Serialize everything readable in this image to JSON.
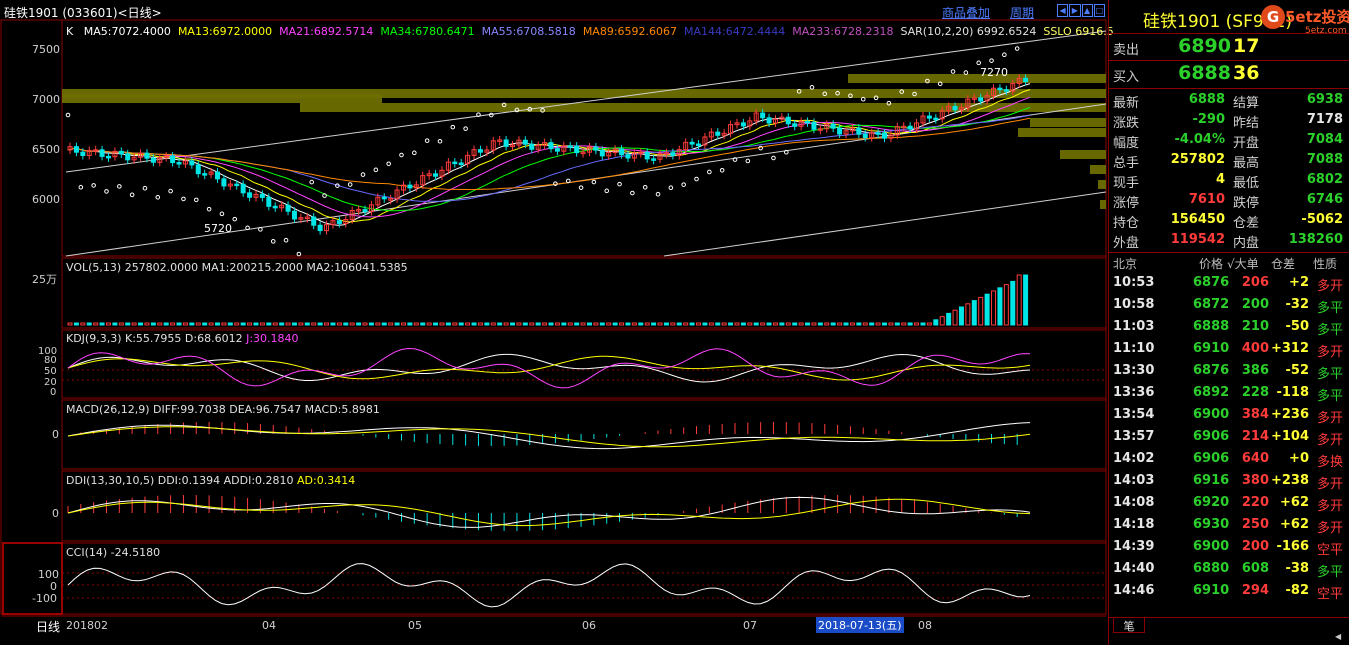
{
  "header": {
    "title": "硅铁1901 (033601)<日线>",
    "overlay_link": "商品叠加",
    "period_link": "周期",
    "btn_icons": [
      "left-arrow-icon",
      "right-arrow-icon",
      "up-arrow-icon",
      "down-arrow-icon",
      "maximize-icon",
      "close-icon"
    ]
  },
  "ma_legend": {
    "k": "K",
    "ma5": "MA5:7072.4000",
    "ma13": "MA13:6972.0000",
    "ma21": "MA21:6892.5714",
    "ma34": "MA34:6780.6471",
    "ma55": "MA55:6708.5818",
    "ma89": "MA89:6592.6067",
    "ma144": "MA144:6472.4444",
    "ma233": "MA233:6728.2318",
    "sar": "SAR(10,2,20) 6992.6524",
    "sslo": "SSLO 6916.5"
  },
  "price_axis": [
    "7500",
    "7000",
    "6500",
    "6000"
  ],
  "price_markers": {
    "high": "7270",
    "low": "5720"
  },
  "vol": {
    "label": "VOL(5,13) 257802.0000 MA1:200215.2000 MA2:106041.5385",
    "axis": "25万"
  },
  "kdj": {
    "label_main": "KDJ(9,3,3) K:55.7955 D:68.6012",
    "label_j": "J:30.1840",
    "axis": [
      "100",
      "80",
      "50",
      "20",
      "0"
    ]
  },
  "macd": {
    "label": "MACD(26,12,9) DIFF:99.7038 DEA:96.7547 MACD:5.8981",
    "axis": "0"
  },
  "ddi": {
    "label": "DDI(13,30,10,5) DDI:0.1394 ADDI:0.2810",
    "label_ad": "AD:0.3414",
    "axis": "0"
  },
  "cci": {
    "label": "CCI(14) -24.5180",
    "axis": [
      "100",
      "0",
      "-100"
    ]
  },
  "date_axis": {
    "period": "日线",
    "labels": [
      "201802",
      "04",
      "05",
      "06",
      "07",
      "08"
    ],
    "cursor_date": "2018-07-13(五)"
  },
  "quote": {
    "name": "硅铁1901 (SF901)",
    "logo": "5etz投资",
    "logo_url": "5etz.com",
    "sell_label": "卖出",
    "sell_price": "6890",
    "sell_vol": "17",
    "buy_label": "买入",
    "buy_price": "6888",
    "buy_vol": "36",
    "rows": [
      {
        "l1": "最新",
        "v1": "6888",
        "c1": "green",
        "l2": "结算",
        "v2": "6938",
        "c2": "green"
      },
      {
        "l1": "涨跌",
        "v1": "-290",
        "c1": "green",
        "l2": "昨结",
        "v2": "7178",
        "c2": "white"
      },
      {
        "l1": "幅度",
        "v1": "-4.04%",
        "c1": "green",
        "l2": "开盘",
        "v2": "7084",
        "c2": "green"
      },
      {
        "l1": "总手",
        "v1": "257802",
        "c1": "yellow",
        "l2": "最高",
        "v2": "7088",
        "c2": "green"
      },
      {
        "l1": "现手",
        "v1": "4",
        "c1": "yellow",
        "l2": "最低",
        "v2": "6802",
        "c2": "green"
      },
      {
        "l1": "涨停",
        "v1": "7610",
        "c1": "red",
        "l2": "跌停",
        "v2": "6746",
        "c2": "green"
      },
      {
        "l1": "持仓",
        "v1": "156450",
        "c1": "yellow",
        "l2": "仓差",
        "v2": "-5062",
        "c2": "yellow"
      },
      {
        "l1": "外盘",
        "v1": "119542",
        "c1": "red",
        "l2": "内盘",
        "v2": "138260",
        "c2": "green"
      }
    ],
    "tick_header": {
      "time": "北京",
      "price": "价格",
      "vol": "√大单",
      "chg": "仓差",
      "nature": "性质"
    },
    "ticks": [
      {
        "t": "10:53",
        "p": "6876",
        "pc": "green",
        "v": "206",
        "vc": "red",
        "d": "+2",
        "n": "多开",
        "nc": "red"
      },
      {
        "t": "10:58",
        "p": "6872",
        "pc": "green",
        "v": "200",
        "vc": "green",
        "d": "-32",
        "n": "多平",
        "nc": "green"
      },
      {
        "t": "11:03",
        "p": "6888",
        "pc": "green",
        "v": "210",
        "vc": "green",
        "d": "-50",
        "n": "多平",
        "nc": "green"
      },
      {
        "t": "11:10",
        "p": "6910",
        "pc": "green",
        "v": "400",
        "vc": "red",
        "d": "+312",
        "n": "多开",
        "nc": "red"
      },
      {
        "t": "13:30",
        "p": "6876",
        "pc": "green",
        "v": "386",
        "vc": "green",
        "d": "-52",
        "n": "多平",
        "nc": "green"
      },
      {
        "t": "13:36",
        "p": "6892",
        "pc": "green",
        "v": "228",
        "vc": "green",
        "d": "-118",
        "n": "多平",
        "nc": "green"
      },
      {
        "t": "13:54",
        "p": "6900",
        "pc": "green",
        "v": "384",
        "vc": "red",
        "d": "+236",
        "n": "多开",
        "nc": "red"
      },
      {
        "t": "13:57",
        "p": "6906",
        "pc": "green",
        "v": "214",
        "vc": "red",
        "d": "+104",
        "n": "多开",
        "nc": "red"
      },
      {
        "t": "14:02",
        "p": "6906",
        "pc": "green",
        "v": "640",
        "vc": "red",
        "d": "+0",
        "n": "多换",
        "nc": "red"
      },
      {
        "t": "14:03",
        "p": "6916",
        "pc": "green",
        "v": "380",
        "vc": "red",
        "d": "+238",
        "n": "多开",
        "nc": "red"
      },
      {
        "t": "14:08",
        "p": "6920",
        "pc": "green",
        "v": "220",
        "vc": "red",
        "d": "+62",
        "n": "多开",
        "nc": "red"
      },
      {
        "t": "14:18",
        "p": "6930",
        "pc": "green",
        "v": "250",
        "vc": "red",
        "d": "+62",
        "n": "多开",
        "nc": "red"
      },
      {
        "t": "14:39",
        "p": "6900",
        "pc": "green",
        "v": "200",
        "vc": "red",
        "d": "-166",
        "n": "空平",
        "nc": "red"
      },
      {
        "t": "14:40",
        "p": "6880",
        "pc": "green",
        "v": "608",
        "vc": "green",
        "d": "-38",
        "n": "多平",
        "nc": "green"
      },
      {
        "t": "14:46",
        "p": "6910",
        "pc": "green",
        "v": "294",
        "vc": "red",
        "d": "-82",
        "n": "空平",
        "nc": "red"
      }
    ],
    "bottom_tab": "笔"
  },
  "colors": {
    "up": "#ff3b3b",
    "down": "#00e5e5",
    "ma5": "#ffffff",
    "ma13": "#ffff00",
    "ma21": "#ff44ff",
    "ma34": "#00ff00",
    "ma55": "#6a6aff",
    "ma89": "#ff8800",
    "grid": "#8a0000"
  }
}
